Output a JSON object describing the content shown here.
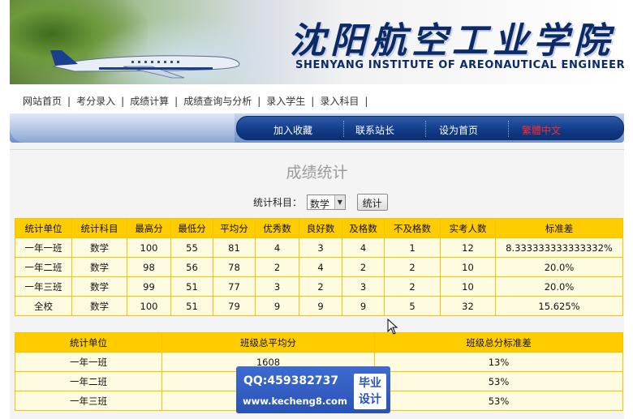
{
  "banner": {
    "title_cn": "沈阳航空工业学院",
    "title_en": "SHENYANG INSTITUTE OF AREONAUTICAL ENGINEERING"
  },
  "top_nav": [
    "网站首页",
    "考分录入",
    "成绩计算",
    "成绩查询与分析",
    "录入学生",
    "录入科目"
  ],
  "blue_nav": [
    {
      "label": "加入收藏",
      "color": "#ffffff"
    },
    {
      "label": "联系站长",
      "color": "#ffffff"
    },
    {
      "label": "设为首页",
      "color": "#ffffff"
    },
    {
      "label": "繁體中文",
      "color": "#ff2a2a"
    }
  ],
  "page_title": "成绩统计",
  "filter": {
    "label": "统计科目：",
    "selected": "数学",
    "button": "统计"
  },
  "stats_table": {
    "headers": [
      "统计单位",
      "统计科目",
      "最高分",
      "最低分",
      "平均分",
      "优秀数",
      "良好数",
      "及格数",
      "不及格数",
      "实考人数",
      "标准差"
    ],
    "rows": [
      [
        "一年一班",
        "数学",
        "100",
        "55",
        "81",
        "4",
        "3",
        "4",
        "1",
        "12",
        "8.333333333333332%"
      ],
      [
        "一年二班",
        "数学",
        "98",
        "56",
        "78",
        "2",
        "4",
        "2",
        "2",
        "10",
        "20.0%"
      ],
      [
        "一年三班",
        "数学",
        "99",
        "51",
        "77",
        "3",
        "2",
        "3",
        "2",
        "10",
        "20.0%"
      ],
      [
        "全校",
        "数学",
        "100",
        "51",
        "79",
        "9",
        "9",
        "9",
        "5",
        "32",
        "15.625%"
      ]
    ]
  },
  "summary_table": {
    "headers": [
      "统计单位",
      "班级总平均分",
      "班级总分标准差"
    ],
    "rows": [
      [
        "一年一班",
        "1608",
        "13%"
      ],
      [
        "一年二班",
        "",
        "53%"
      ],
      [
        "一年三班",
        "",
        "53%"
      ]
    ]
  },
  "watermark": {
    "qq": "QQ:459382737",
    "url": "www.kecheng8.com",
    "badge_line1": "毕业",
    "badge_line2": "设计"
  },
  "colors": {
    "table_header": "#ffcc00",
    "table_cell": "#fffbe0",
    "nav_pill": "#123d8a",
    "title_blue": "#0b2a66"
  }
}
